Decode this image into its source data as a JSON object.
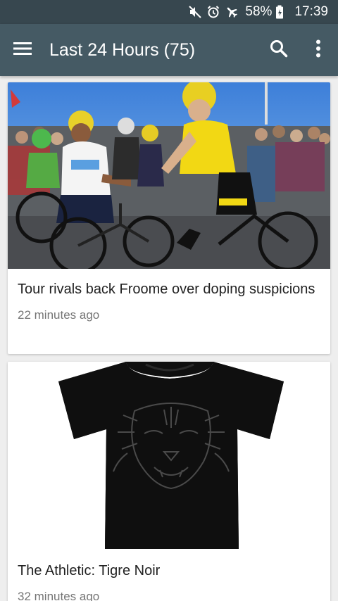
{
  "status_bar": {
    "battery_percent": "58%",
    "time": "17:39",
    "icons": [
      "mute-icon",
      "alarm-icon",
      "airplane-icon",
      "battery-icon"
    ]
  },
  "app_bar": {
    "title": "Last 24 Hours (75)",
    "icons": [
      "menu-icon",
      "search-icon",
      "more-vert-icon"
    ]
  },
  "feed": {
    "items": [
      {
        "title": "Tour rivals back Froome over doping suspicions",
        "time": "22 minutes ago",
        "image": "cyclists-handshake-photo"
      },
      {
        "title": "The Athletic: Tigre Noir",
        "time": "32 minutes ago",
        "image": "black-tiger-tshirt-photo"
      }
    ]
  },
  "colors": {
    "status_bar": "#37474f",
    "app_bar": "#455a64",
    "background": "#eeeeee",
    "card": "#ffffff",
    "secondary_text": "#757575"
  }
}
